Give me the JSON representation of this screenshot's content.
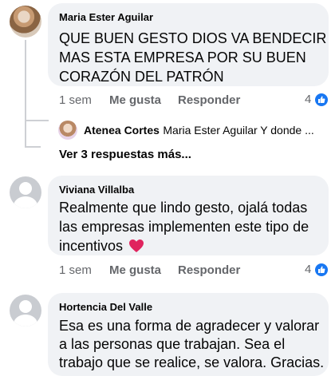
{
  "comments": [
    {
      "author": "Maria Ester Aguilar",
      "text_lines": [
        "QUE BUEN GESTO DIOS VA BENDECIR",
        "MAS ESTA EMPRESA POR SU BUEN",
        "CORAZÓN DEL PATRÓN"
      ],
      "time": "1 sem",
      "like_label": "Me gusta",
      "reply_label": "Responder",
      "reaction_count": "4",
      "avatar_icon": "profile-photo"
    },
    {
      "author": "Viviana Villalba",
      "text_lines": [
        "Realmente que lindo gesto, ojalá todas",
        "las empresas implementen este tipo de",
        "incentivos"
      ],
      "emoji": "heart-emoji",
      "time": "1 sem",
      "like_label": "Me gusta",
      "reply_label": "Responder",
      "reaction_count": "4",
      "avatar_icon": "default-avatar"
    },
    {
      "author": "Hortencia Del Valle",
      "text_lines": [
        "Esa es una forma de agradecer y valorar",
        "a las personas que trabajan. Sea el",
        "trabajo que se realice, se valora. Gracias."
      ],
      "avatar_icon": "default-avatar"
    }
  ],
  "reply_preview": {
    "author": "Atenea Cortes",
    "snippet": "Maria Ester Aguilar Y donde ..."
  },
  "more_replies_label": "Ver 3 respuestas más...",
  "colors": {
    "bubble": "#f0f2f5",
    "secondary_text": "#65676b",
    "like_blue": "#1877f2",
    "heart_red": "#f33e58"
  }
}
